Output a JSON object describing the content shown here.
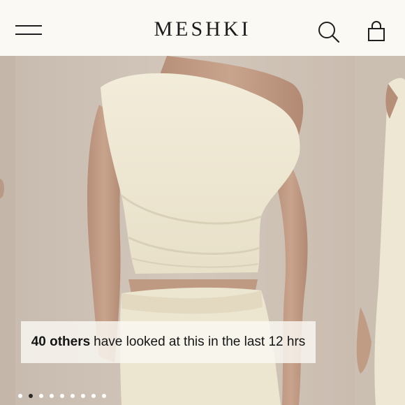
{
  "header": {
    "logo": "MESHKI",
    "icons": {
      "menu": "hamburger-menu-icon",
      "search": "search-icon",
      "bag": "shopping-bag-icon"
    }
  },
  "gallery": {
    "notice": {
      "count_text": "40 others",
      "rest_text": "have looked at this in the last 12 hrs"
    },
    "slide_count": 9,
    "active_index": 1
  },
  "colors": {
    "header_bg": "#fbf9f3",
    "photo_bg": "#c9bcaf",
    "garment": "#efe9d6",
    "text": "#1b1b1b"
  }
}
